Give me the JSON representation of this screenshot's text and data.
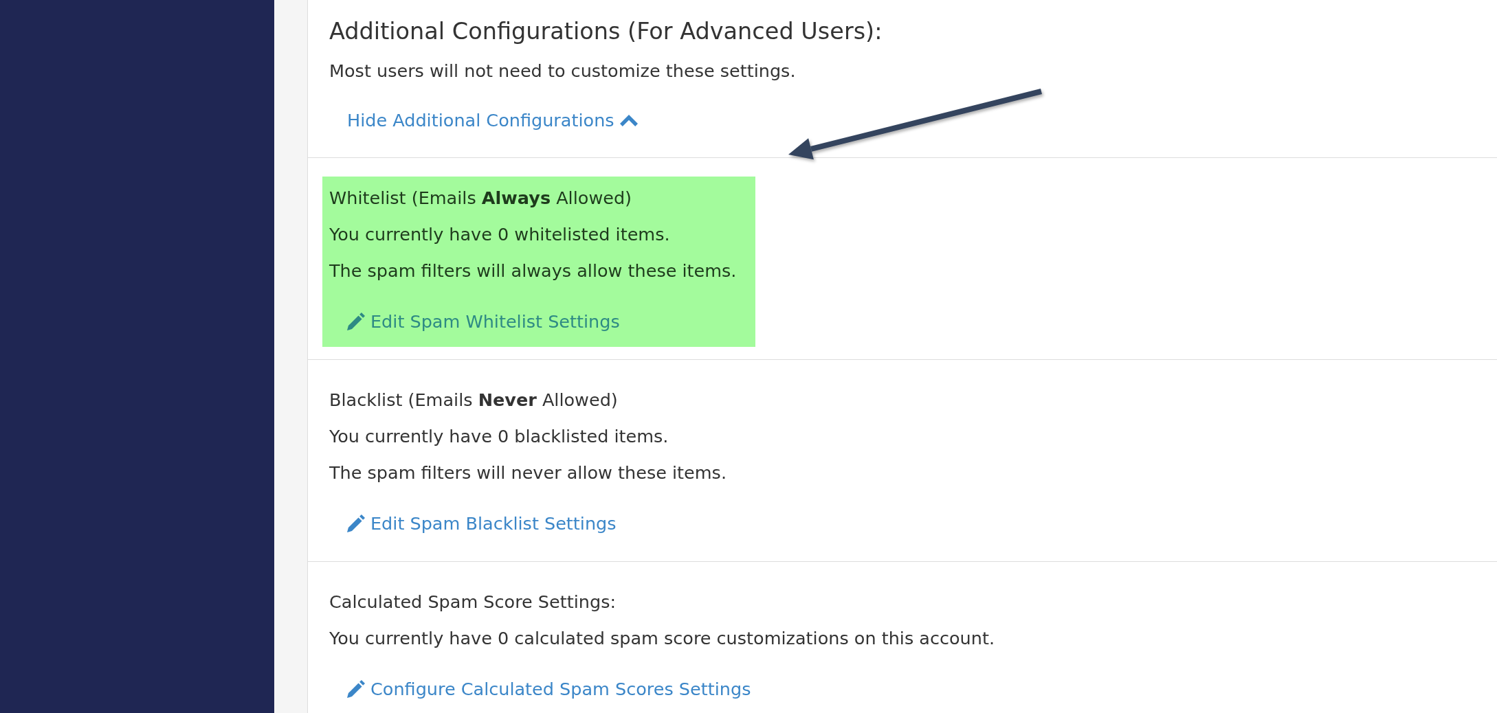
{
  "header": {
    "title": "Additional Configurations (For Advanced Users):",
    "description": "Most users will not need to customize these settings.",
    "toggle_link": {
      "label": "Hide Additional Configurations",
      "expanded": true
    }
  },
  "sections": [
    {
      "title": "Whitelist (Emails **Always** Allowed)",
      "lines": [
        "You currently have 0 whitelisted items.",
        "The spam filters will always allow these items."
      ],
      "link": "Edit Spam Whitelist Settings",
      "highlighted": true
    },
    {
      "title": "Blacklist (Emails **Never** Allowed)",
      "lines": [
        "You currently have 0 blacklisted items.",
        "The spam filters will never allow these items."
      ],
      "link": "Edit Spam Blacklist Settings",
      "highlighted": false
    },
    {
      "title": "Calculated Spam Score Settings:",
      "lines": [
        "You currently have 0 calculated spam score customizations on this account."
      ],
      "link": "Configure Calculated Spam Scores Settings",
      "highlighted": false
    }
  ]
}
